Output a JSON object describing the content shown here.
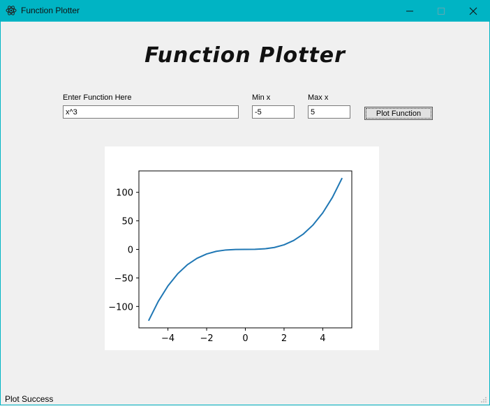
{
  "window": {
    "title": "Function Plotter",
    "titlebar_color": "#00b4c4",
    "controls": [
      "minimize-icon",
      "maximize-icon",
      "close-icon"
    ]
  },
  "heading": "Function Plotter",
  "form": {
    "function_label": "Enter Function Here",
    "function_value": "x^3",
    "min_label": "Min x",
    "min_value": "-5",
    "max_label": "Max x",
    "max_value": "5",
    "plot_button": "Plot Function"
  },
  "status": "Plot Success",
  "chart_data": {
    "type": "line",
    "title": "",
    "xlabel": "",
    "ylabel": "",
    "xlim": [
      -5.5,
      5.5
    ],
    "ylim": [
      -137.5,
      137.5
    ],
    "x_ticks": [
      -4,
      -2,
      0,
      2,
      4
    ],
    "x_tick_labels": [
      "−4",
      "−2",
      "0",
      "2",
      "4"
    ],
    "y_ticks": [
      -100,
      -50,
      0,
      50,
      100
    ],
    "y_tick_labels": [
      "−100",
      "−50",
      "0",
      "50",
      "100"
    ],
    "grid": false,
    "series": [
      {
        "color": "#1f77b4",
        "x": [
          -5,
          -4.5,
          -4,
          -3.5,
          -3,
          -2.5,
          -2,
          -1.5,
          -1,
          -0.5,
          0,
          0.5,
          1,
          1.5,
          2,
          2.5,
          3,
          3.5,
          4,
          4.5,
          5
        ],
        "y": [
          -125,
          -91.125,
          -64,
          -42.875,
          -27,
          -15.625,
          -8,
          -3.375,
          -1,
          -0.125,
          0,
          0.125,
          1,
          3.375,
          8,
          15.625,
          27,
          42.875,
          64,
          91.125,
          125
        ]
      }
    ]
  }
}
